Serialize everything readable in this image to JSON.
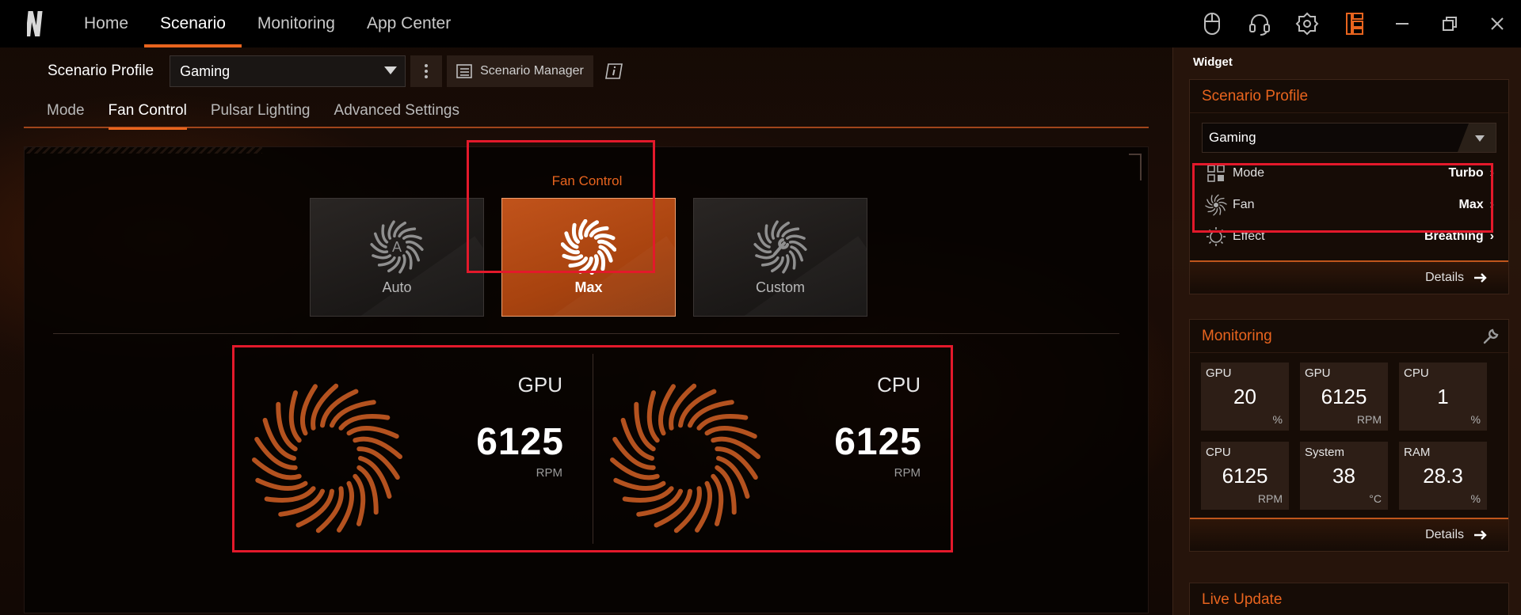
{
  "colors": {
    "accent": "#e8641e",
    "highlight": "#e3192b",
    "background": "#0b0705"
  },
  "topnav": {
    "items": [
      {
        "label": "Home",
        "active": false
      },
      {
        "label": "Scenario",
        "active": true
      },
      {
        "label": "Monitoring",
        "active": false
      },
      {
        "label": "App Center",
        "active": false
      }
    ],
    "icons": [
      "mouse-icon",
      "headset-icon",
      "settings-gear-icon",
      "widget-panel-icon",
      "minimize-icon",
      "restore-icon",
      "close-icon"
    ]
  },
  "scenario": {
    "profile_label": "Scenario Profile",
    "profile_value": "Gaming",
    "manager_label": "Scenario Manager"
  },
  "subtabs": [
    {
      "label": "Mode",
      "active": false
    },
    {
      "label": "Fan Control",
      "active": true
    },
    {
      "label": "Pulsar Lighting",
      "active": false
    },
    {
      "label": "Advanced Settings",
      "active": false
    }
  ],
  "fan_control": {
    "title": "Fan Control",
    "options": [
      {
        "label": "Auto",
        "selected": false
      },
      {
        "label": "Max",
        "selected": true
      },
      {
        "label": "Custom",
        "selected": false
      }
    ],
    "gpu": {
      "name": "GPU",
      "value": "6125",
      "unit": "RPM"
    },
    "cpu": {
      "name": "CPU",
      "value": "6125",
      "unit": "RPM"
    }
  },
  "widget": {
    "title": "Widget",
    "scenario_card": {
      "title": "Scenario Profile",
      "profile_value": "Gaming",
      "rows": [
        {
          "label": "Mode",
          "value": "Turbo"
        },
        {
          "label": "Fan",
          "value": "Max"
        },
        {
          "label": "Effect",
          "value": "Breathing"
        }
      ],
      "details_label": "Details"
    },
    "monitoring_card": {
      "title": "Monitoring",
      "cells": [
        {
          "label": "GPU",
          "value": "20",
          "unit": "%"
        },
        {
          "label": "GPU",
          "value": "6125",
          "unit": "RPM"
        },
        {
          "label": "CPU",
          "value": "1",
          "unit": "%"
        },
        {
          "label": "CPU",
          "value": "6125",
          "unit": "RPM"
        },
        {
          "label": "System",
          "value": "38",
          "unit": "°C"
        },
        {
          "label": "RAM",
          "value": "28.3",
          "unit": "%"
        }
      ],
      "details_label": "Details"
    },
    "live_update_title": "Live Update"
  }
}
